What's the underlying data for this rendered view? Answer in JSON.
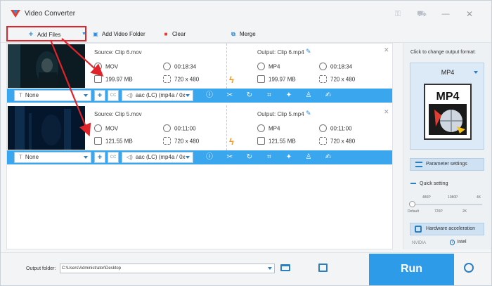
{
  "window": {
    "title": "Video Converter",
    "colors": {
      "accent": "#2d9be8",
      "highlight": "#e0242a",
      "bolt": "#f7931e",
      "optbar": "#3aa6ee"
    }
  },
  "toolbar": {
    "add_files": "Add Files",
    "add_video_folder": "Add Video Folder",
    "clear": "Clear",
    "merge": "Merge"
  },
  "files": [
    {
      "source_label": "Source: Clip 6.mov",
      "source_format": "MOV",
      "source_duration": "00:18:34",
      "source_size": "199.97 MB",
      "source_resolution": "720 x 480",
      "output_label": "Output: Clip 6.mp4",
      "output_format": "MP4",
      "output_duration": "00:18:34",
      "output_size": "199.97 MB",
      "output_resolution": "720 x 480",
      "subtitle": "None",
      "audio": "aac (LC) (mp4a / 0x"
    },
    {
      "source_label": "Source: Clip 5.mov",
      "source_format": "MOV",
      "source_duration": "00:11:00",
      "source_size": "121.55 MB",
      "source_resolution": "720 x 480",
      "output_label": "Output: Clip 5.mp4",
      "output_format": "MP4",
      "output_duration": "00:11:00",
      "output_size": "121.55 MB",
      "output_resolution": "720 x 480",
      "subtitle": "None",
      "audio": "aac (LC) (mp4a / 0x"
    }
  ],
  "right_panel": {
    "title": "Click to change output format:",
    "format": "MP4",
    "format_art_text": "MP4",
    "parameter_settings": "Parameter settings",
    "quick_setting": "Quick setting",
    "quality_top": [
      "480P",
      "1080P",
      "4K"
    ],
    "quality_bottom": [
      "Default",
      "720P",
      "2K"
    ],
    "hardware_acceleration": "Hardware acceleration",
    "gpu_nvidia": "NVIDIA",
    "gpu_intel": "Intel"
  },
  "bottom": {
    "output_folder_label": "Output folder:",
    "output_folder_value": "C:\\Users\\Administrator\\Desktop",
    "run": "Run"
  }
}
